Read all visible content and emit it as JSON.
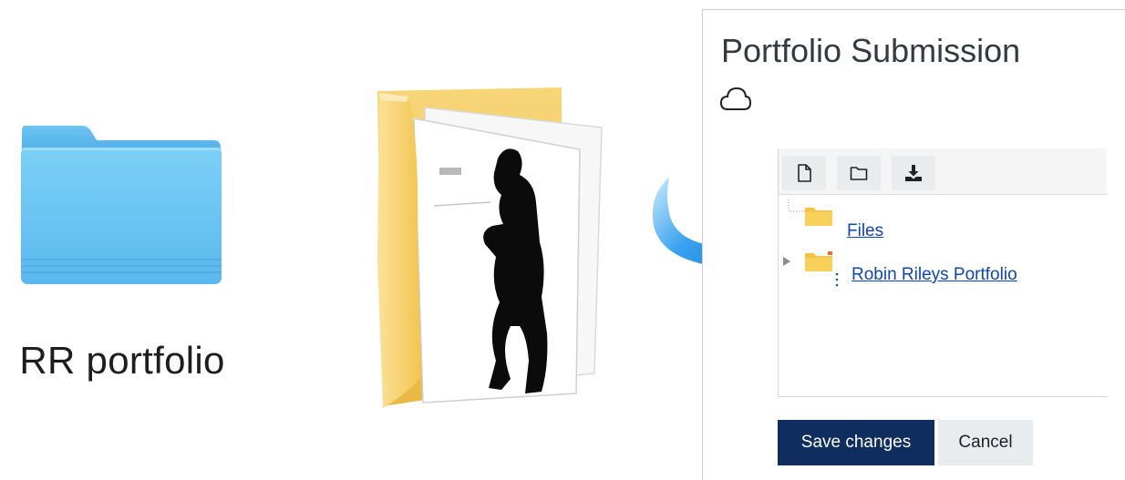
{
  "mac_folder": {
    "label": "RR portfolio",
    "icon": "folder-icon"
  },
  "windows_folder": {
    "icon": "folder-with-documents-icon"
  },
  "arrow": {
    "icon": "curved-arrow-icon"
  },
  "panel": {
    "title": "Portfolio Submission",
    "cloud_icon": "cloud-icon",
    "toolbar": {
      "buttons": [
        {
          "icon": "new-file-icon"
        },
        {
          "icon": "new-folder-icon"
        },
        {
          "icon": "download-icon"
        }
      ]
    },
    "tree": [
      {
        "label": "Files",
        "icon": "folder-icon"
      },
      {
        "label": "Robin Rileys Portfolio",
        "icon": "folder-icon"
      }
    ],
    "save_label": "Save changes",
    "cancel_label": "Cancel"
  },
  "colors": {
    "link": "#0f47ad",
    "save_bg": "#0f2d5e",
    "mac_folder": "#62bdf0",
    "win_folder": "#f5cf68",
    "arrow": "#2f96e6"
  }
}
